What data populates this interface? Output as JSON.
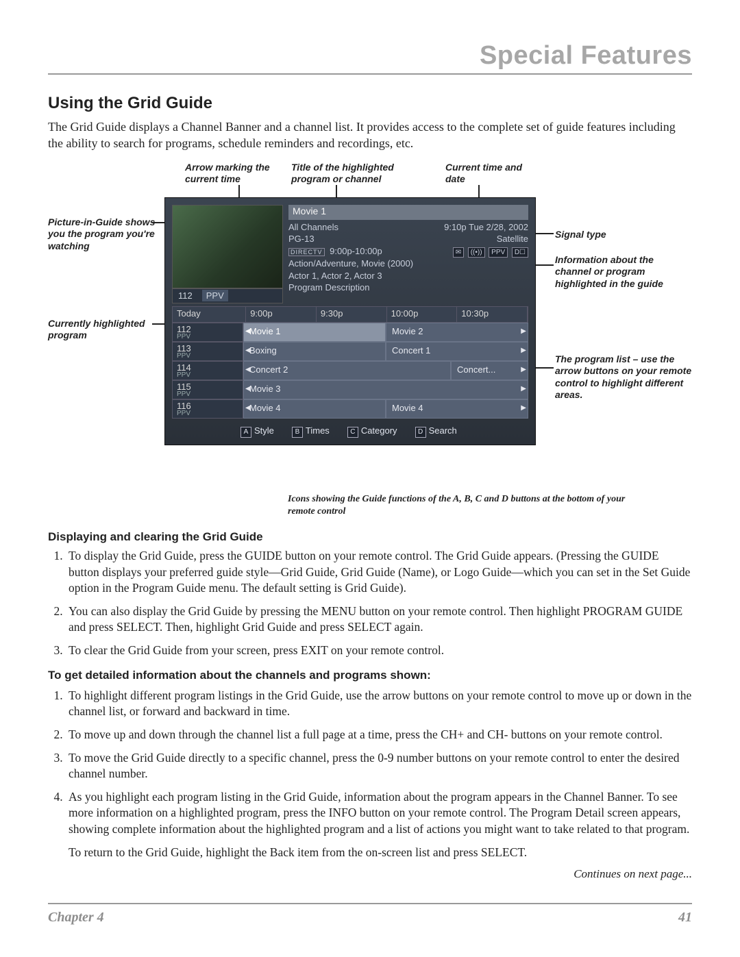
{
  "header": {
    "title": "Special Features"
  },
  "section": {
    "h2": "Using the Grid Guide",
    "intro": "The Grid Guide displays a Channel Banner and a channel list. It provides access to the complete set of guide features including the ability to search for programs, schedule reminders and recordings, etc."
  },
  "callouts": {
    "arrow_time": "Arrow marking the current time",
    "title_prog": "Title of the highlighted program or channel",
    "cur_time": "Current time and date",
    "pig": "Picture-in-Guide shows you the program you're watching",
    "signal": "Signal type",
    "info": "Information about the channel or program highlighted in the guide",
    "cur_hl": "Currently highlighted program",
    "proglist": "The program list – use the arrow buttons on your remote control to highlight different areas.",
    "bottom_icons": "Icons showing the Guide functions of the A, B, C and D buttons at the bottom of your remote control"
  },
  "tv": {
    "pig_channel_num": "112",
    "pig_channel_tag": "PPV",
    "title": "Movie 1",
    "info": {
      "all_channels": "All Channels",
      "rating": "PG-13",
      "time_range": "9:00p-10:00p",
      "clock": "9:10p Tue 2/28, 2002",
      "signal": "Satellite",
      "genre": "Action/Adventure, Movie (2000)",
      "actors": "Actor 1, Actor 2, Actor 3",
      "desc": "Program Description",
      "brand": "DIRECTV"
    },
    "icons": [
      "✉",
      "((•))",
      "PPV",
      "D☐"
    ],
    "time_header": [
      "Today",
      "9:00p",
      "9:30p",
      "10:00p",
      "10:30p"
    ],
    "rows": [
      {
        "ch": "112",
        "tag": "PPV",
        "cells": [
          {
            "t": "Movie 1",
            "hl": true,
            "span": 2,
            "la": true
          },
          {
            "t": "Movie 2",
            "span": 2,
            "ra": true
          }
        ]
      },
      {
        "ch": "113",
        "tag": "PPV",
        "cells": [
          {
            "t": "Boxing",
            "span": 2,
            "la": true
          },
          {
            "t": "Concert 1",
            "span": 2,
            "ra": true
          }
        ]
      },
      {
        "ch": "114",
        "tag": "PPV",
        "cells": [
          {
            "t": "Concert 2",
            "span": 3,
            "la": true
          },
          {
            "t": "Concert...",
            "span": 1,
            "ra": true
          }
        ]
      },
      {
        "ch": "115",
        "tag": "PPV",
        "cells": [
          {
            "t": "Movie 3",
            "span": 4,
            "la": true,
            "ra": true
          }
        ]
      },
      {
        "ch": "116",
        "tag": "PPV",
        "cells": [
          {
            "t": "Movie 4",
            "span": 2,
            "la": true
          },
          {
            "t": "Movie 4",
            "span": 2,
            "ra": true
          }
        ]
      }
    ],
    "footer": [
      {
        "k": "A",
        "t": "Style"
      },
      {
        "k": "B",
        "t": "Times"
      },
      {
        "k": "C",
        "t": "Category"
      },
      {
        "k": "D",
        "t": "Search"
      }
    ]
  },
  "subsections": {
    "disp_head": "Displaying and clearing the Grid Guide",
    "disp_steps": [
      "To display the Grid Guide, press the GUIDE button on your remote control. The Grid Guide appears. (Pressing the GUIDE button displays your preferred guide style—Grid Guide, Grid Guide (Name), or Logo Guide—which you can set in the Set Guide option in the Program Guide menu. The default setting is Grid Guide).",
      "You can also display the Grid Guide by pressing the MENU button on your remote control. Then highlight PROGRAM GUIDE and press SELECT. Then, highlight Grid Guide and press SELECT again.",
      "To clear the Grid Guide from your screen, press EXIT on your remote control."
    ],
    "detail_head": "To get detailed information about the channels and programs shown:",
    "detail_steps": [
      "To highlight different program listings in the Grid Guide, use the arrow buttons on your remote control to move up or down in the channel list, or forward and backward in time.",
      "To move up and down through the channel list a full page at a time, press the CH+ and CH- buttons on your remote control.",
      "To move the Grid Guide directly to a specific channel, press the 0-9 number buttons on your remote control to enter the desired channel number.",
      "As you highlight each program listing in the Grid Guide, information about the program appears in the Channel Banner. To see more information on a highlighted program, press the INFO button on your remote control. The Program Detail screen appears, showing complete information about the highlighted program and a list of actions you might want to take related to that program."
    ],
    "detail_followup": "To return to the Grid Guide, highlight the Back item from the on-screen list and press SELECT.",
    "continues": "Continues on next page..."
  },
  "footer": {
    "chapter": "Chapter 4",
    "page": "41"
  }
}
